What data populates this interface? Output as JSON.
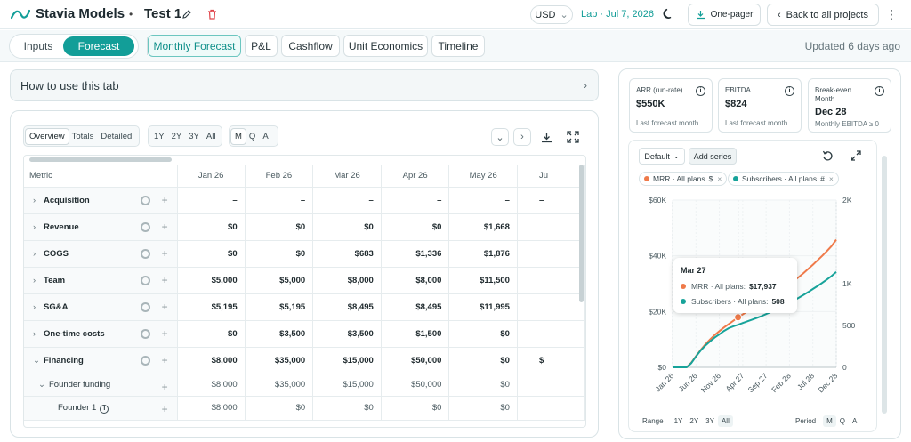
{
  "header": {
    "brand": "Stavia Models",
    "separator": "•",
    "project": "Test 1",
    "currency": "USD",
    "lab_label": "Lab · Jul 7, 2026",
    "one_pager": "One-pager",
    "back": "Back to all projects",
    "accent": "#129e98"
  },
  "nav": {
    "seg": [
      "Inputs",
      "Forecast"
    ],
    "tabs": [
      "Monthly Forecast",
      "P&L",
      "Cashflow",
      "Unit Economics",
      "Timeline"
    ],
    "updated": "Updated 6 days ago"
  },
  "howto": "How to use this tab",
  "controls": {
    "view": [
      "Overview",
      "Totals",
      "Detailed"
    ],
    "span": [
      "1Y",
      "2Y",
      "3Y",
      "All"
    ],
    "period": [
      "M",
      "Q",
      "A"
    ]
  },
  "table": {
    "metric_header": "Metric",
    "months": [
      "Jan 26",
      "Feb 26",
      "Mar 26",
      "Apr 26",
      "May 26",
      "Ju"
    ],
    "rows": [
      {
        "name": "Acquisition",
        "values": [
          "–",
          "–",
          "–",
          "–",
          "–",
          "–"
        ]
      },
      {
        "name": "Revenue",
        "values": [
          "$0",
          "$0",
          "$0",
          "$0",
          "$1,668",
          ""
        ]
      },
      {
        "name": "COGS",
        "values": [
          "$0",
          "$0",
          "$683",
          "$1,336",
          "$1,876",
          ""
        ]
      },
      {
        "name": "Team",
        "values": [
          "$5,000",
          "$5,000",
          "$8,000",
          "$8,000",
          "$11,500",
          ""
        ]
      },
      {
        "name": "SG&A",
        "values": [
          "$5,195",
          "$5,195",
          "$8,495",
          "$8,495",
          "$11,995",
          ""
        ]
      },
      {
        "name": "One-time costs",
        "values": [
          "$0",
          "$3,500",
          "$3,500",
          "$1,500",
          "$0",
          ""
        ]
      },
      {
        "name": "Financing",
        "values": [
          "$8,000",
          "$35,000",
          "$15,000",
          "$50,000",
          "$0",
          "$"
        ]
      }
    ],
    "sub_rows": [
      {
        "name": "Founder funding",
        "values": [
          "$8,000",
          "$35,000",
          "$15,000",
          "$50,000",
          "$0",
          ""
        ]
      },
      {
        "name": "Founder 1",
        "values": [
          "$8,000",
          "$0",
          "$0",
          "$0",
          "$0",
          ""
        ]
      }
    ]
  },
  "kpis": [
    {
      "label": "ARR (run-rate)",
      "value": "$550K",
      "sub": "Last forecast month"
    },
    {
      "label": "EBITDA",
      "value": "$824",
      "sub": "Last forecast month"
    },
    {
      "label": "Break-even Month",
      "value": "Dec 28",
      "sub": "Monthly EBITDA ≥ 0"
    }
  ],
  "chart_controls": {
    "default": "Default",
    "add_series": "Add series",
    "chips": [
      {
        "label": "MRR · All plans",
        "unit": "$",
        "color": "#ef7a4a"
      },
      {
        "label": "Subscribers · All plans",
        "unit": "#",
        "color": "#17a39a"
      }
    ],
    "range_label": "Range",
    "range": [
      "1Y",
      "2Y",
      "3Y",
      "All"
    ],
    "period_label": "Period",
    "period": [
      "M",
      "Q",
      "A"
    ]
  },
  "chart_data": {
    "type": "line",
    "x": [
      "Jan 26",
      "Feb 26",
      "Mar 26",
      "Apr 26",
      "May 26",
      "Jun 26",
      "Jul 26",
      "Aug 26",
      "Sep 26",
      "Oct 26",
      "Nov 26",
      "Dec 26",
      "Jan 27",
      "Feb 27",
      "Mar 27",
      "Apr 27",
      "May 27",
      "Jun 27",
      "Jul 27",
      "Aug 27",
      "Sep 27",
      "Oct 27",
      "Nov 27",
      "Dec 27",
      "Jan 28",
      "Feb 28",
      "Mar 28",
      "Apr 28",
      "May 28",
      "Jun 28",
      "Jul 28",
      "Aug 28",
      "Sep 28",
      "Oct 28",
      "Nov 28",
      "Dec 28"
    ],
    "xticks": [
      "Jan 26",
      "Jun 26",
      "Nov 26",
      "Apr 27",
      "Sep 27",
      "Feb 28",
      "Jul 28",
      "Dec 28"
    ],
    "series": [
      {
        "name": "MRR · All plans",
        "axis": "left",
        "color": "#ef7a4a",
        "values": [
          0,
          0,
          0,
          0,
          1668,
          4000,
          6200,
          8200,
          10000,
          11600,
          13000,
          14300,
          15500,
          16700,
          17937,
          19000,
          20000,
          21000,
          22000,
          23000,
          24100,
          25200,
          26300,
          27400,
          28600,
          29800,
          31100,
          32400,
          33800,
          35300,
          36800,
          38400,
          40000,
          41700,
          43500,
          45800
        ]
      },
      {
        "name": "Subscribers · All plans",
        "axis": "right",
        "color": "#17a39a",
        "values": [
          0,
          0,
          0,
          0,
          50,
          130,
          200,
          260,
          310,
          355,
          395,
          435,
          468,
          490,
          508,
          530,
          550,
          570,
          590,
          612,
          636,
          660,
          686,
          712,
          740,
          770,
          800,
          832,
          866,
          900,
          936,
          972,
          1010,
          1050,
          1092,
          1140
        ]
      }
    ],
    "ylim_left": [
      0,
      60000
    ],
    "yticks_left": [
      "$0",
      "$20K",
      "$40K",
      "$60K"
    ],
    "ylim_right": [
      0,
      2000
    ],
    "yticks_right": [
      "0",
      "500",
      "1K",
      "2K"
    ],
    "tooltip": {
      "month": "Mar 27",
      "rows": [
        {
          "label": "MRR · All plans:",
          "value": "$17,937",
          "color": "#ef7a4a"
        },
        {
          "label": "Subscribers · All plans:",
          "value": "508",
          "color": "#17a39a"
        }
      ]
    }
  }
}
